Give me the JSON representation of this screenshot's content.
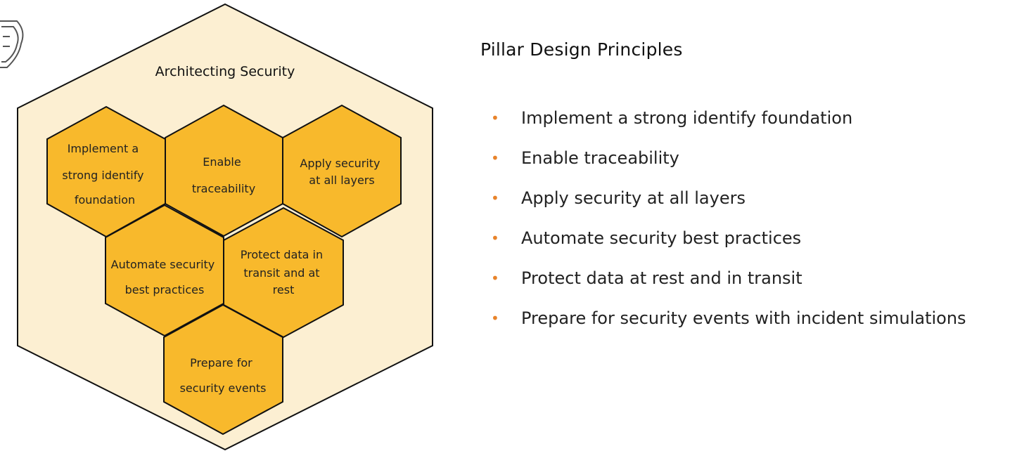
{
  "diagram": {
    "title": "Architecting Security",
    "colors": {
      "outer_fill": "#fcefd2",
      "hex_fill": "#f8b92c",
      "stroke": "#111111"
    },
    "icon": "shield-badge-icon",
    "hexagons": [
      {
        "id": "identity",
        "lines": [
          "Implement a",
          "strong identify",
          "foundation"
        ]
      },
      {
        "id": "traceability",
        "lines": [
          "Enable",
          "traceability"
        ]
      },
      {
        "id": "all-layers",
        "lines": [
          "Apply security",
          "at all layers"
        ]
      },
      {
        "id": "automate",
        "lines": [
          "Automate security",
          "best practices"
        ]
      },
      {
        "id": "protect-data",
        "lines": [
          "Protect data in",
          "transit and at",
          "rest"
        ]
      },
      {
        "id": "prepare",
        "lines": [
          "Prepare for",
          "security events"
        ]
      }
    ]
  },
  "panel": {
    "title": "Pillar Design Principles",
    "bullet_color": "#e8832a",
    "principles": [
      "Implement a strong identify foundation",
      "Enable traceability",
      "Apply security at all layers",
      "Automate security best practices",
      "Protect data at rest and in transit",
      "Prepare for security events with incident simulations"
    ]
  }
}
